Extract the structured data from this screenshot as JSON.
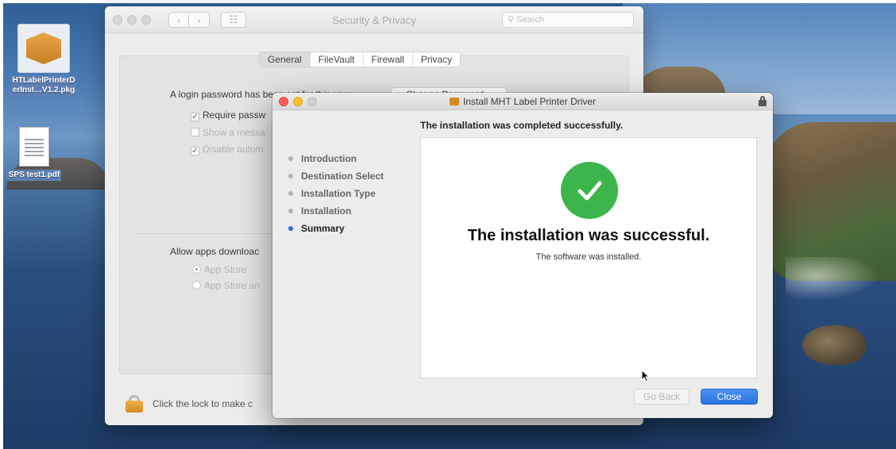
{
  "desktop": {
    "icons": [
      {
        "name": "package-file",
        "label_line1": "HTLabelPrinterD",
        "label_line2": "erInst…V1.2.pkg"
      },
      {
        "name": "pdf-file",
        "label_line1": "SPS test1.pdf"
      }
    ]
  },
  "security_window": {
    "title": "Security & Privacy",
    "search_placeholder": "Search",
    "tabs": [
      "General",
      "FileVault",
      "Firewall",
      "Privacy"
    ],
    "selected_tab": "General",
    "login_password_text": "A login password has been set for this user",
    "change_password_label": "Change Password...",
    "require_password_label": "Require passw",
    "show_message_label": "Show a messa",
    "disable_auto_label": "Disable autom",
    "allow_apps_label": "Allow apps downloac",
    "radio_app_store": "App Store",
    "radio_app_store_and": "App Store an",
    "lock_text": "Click the lock to make c"
  },
  "installer": {
    "title": "Install MHT Label Printer Driver",
    "header": "The installation was completed successfully.",
    "steps": [
      "Introduction",
      "Destination Select",
      "Installation Type",
      "Installation",
      "Summary"
    ],
    "active_step": "Summary",
    "success_title": "The installation was successful.",
    "success_subtitle": "The software was installed.",
    "go_back_label": "Go Back",
    "close_label": "Close"
  },
  "colors": {
    "success_green": "#3cb54a",
    "accent_blue": "#2a74e0",
    "close_red": "#ff5f57",
    "minimize_yellow": "#ffbd2e"
  }
}
